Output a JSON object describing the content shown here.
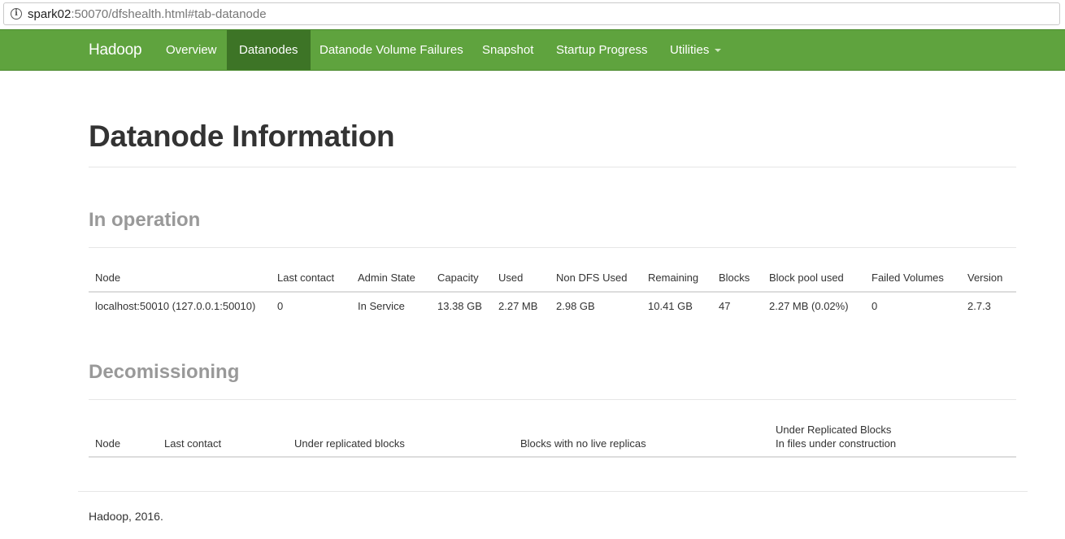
{
  "browser": {
    "url_host": "spark02",
    "url_rest": ":50070/dfshealth.html#tab-datanode",
    "info_icon": "info-icon"
  },
  "navbar": {
    "brand": "Hadoop",
    "items": [
      {
        "label": "Overview"
      },
      {
        "label": "Datanodes",
        "active": true
      },
      {
        "label": "Datanode Volume Failures"
      },
      {
        "label": "Snapshot"
      },
      {
        "label": "Startup Progress"
      },
      {
        "label": "Utilities",
        "dropdown": true
      }
    ],
    "colors": {
      "bar": "#5fa33e",
      "active": "#3d7426"
    }
  },
  "page": {
    "title": "Datanode Information"
  },
  "in_operation": {
    "title": "In operation",
    "columns": [
      "Node",
      "Last contact",
      "Admin State",
      "Capacity",
      "Used",
      "Non DFS Used",
      "Remaining",
      "Blocks",
      "Block pool used",
      "Failed Volumes",
      "Version"
    ],
    "rows": [
      [
        "localhost:50010 (127.0.0.1:50010)",
        "0",
        "In Service",
        "13.38 GB",
        "2.27 MB",
        "2.98 GB",
        "10.41 GB",
        "47",
        "2.27 MB (0.02%)",
        "0",
        "2.7.3"
      ]
    ]
  },
  "decommissioning": {
    "title": "Decomissioning",
    "columns": [
      "Node",
      "Last contact",
      "Under replicated blocks",
      "Blocks with no live replicas",
      "Under Replicated Blocks",
      "In files under construction"
    ]
  },
  "footer": {
    "text": "Hadoop, 2016."
  }
}
